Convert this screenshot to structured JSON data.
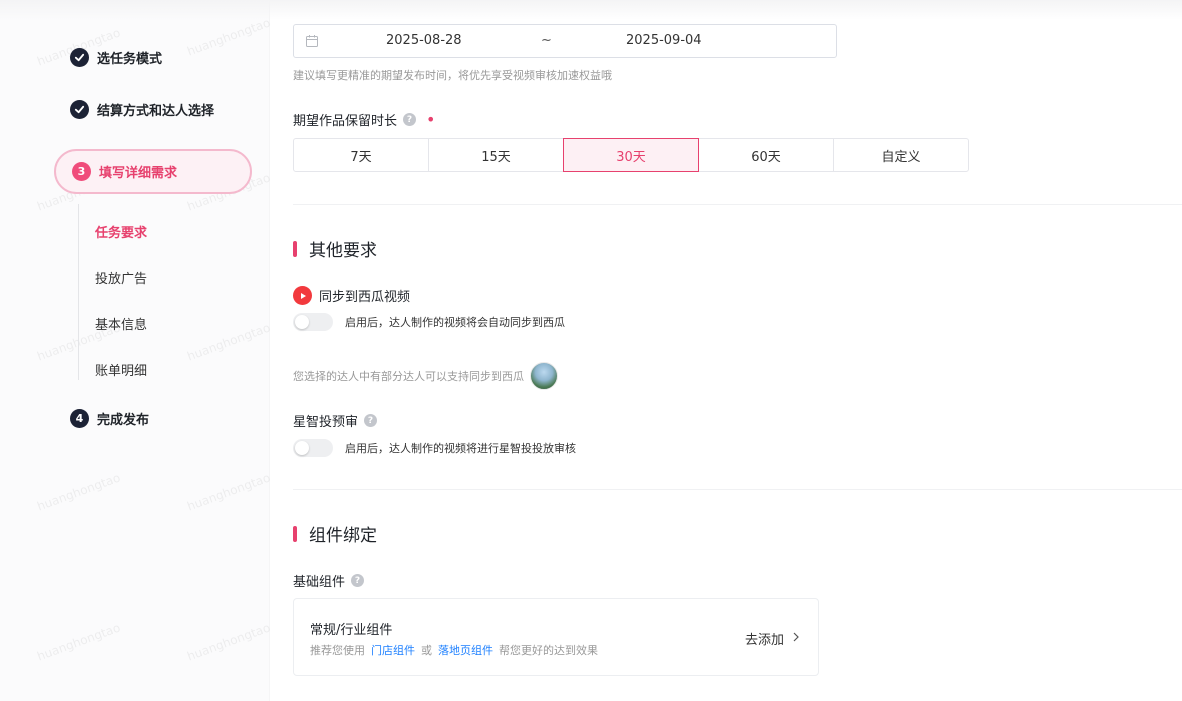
{
  "sidebar": {
    "steps": [
      {
        "label": "选任务模式",
        "state": "done"
      },
      {
        "label": "结算方式和达人选择",
        "state": "done"
      },
      {
        "number": "3",
        "label": "填写详细需求",
        "state": "active"
      },
      {
        "number": "4",
        "label": "完成发布",
        "state": "pending"
      }
    ],
    "substeps": [
      "任务要求",
      "投放广告",
      "基本信息",
      "账单明细"
    ],
    "watermark": "huanghongtao"
  },
  "date_range": {
    "start": "2025-08-28",
    "separator": "~",
    "end": "2025-09-04",
    "hint": "建议填写更精准的期望发布时间，将优先享受视频审核加速权益哦"
  },
  "retention": {
    "label": "期望作品保留时长",
    "required_mark": "•",
    "options": [
      "7天",
      "15天",
      "30天",
      "60天",
      "自定义"
    ],
    "selected": "30天"
  },
  "other_section": {
    "title": "其他要求",
    "xigua": {
      "label": "同步到西瓜视频",
      "toggle_desc": "启用后，达人制作的视频将会自动同步到西瓜",
      "support_text": "您选择的达人中有部分达人可以支持同步到西瓜"
    },
    "review": {
      "label": "星智投预审",
      "toggle_desc": "启用后，达人制作的视频将进行星智投投放审核"
    }
  },
  "component_section": {
    "title": "组件绑定",
    "basic_label": "基础组件",
    "card": {
      "title": "常规/行业组件",
      "desc_prefix": "推荐您使用",
      "link1": "门店组件",
      "desc_or": "或",
      "link2": "落地页组件",
      "desc_suffix": "帮您更好的达到效果",
      "action": "去添加"
    }
  },
  "colors": {
    "accent": "#e7416e",
    "link": "#1e80ff",
    "step_dark": "#1c2235"
  },
  "icons": [
    "check-icon",
    "calendar-icon",
    "question-icon",
    "xigua-play-icon",
    "chevron-right-icon"
  ]
}
